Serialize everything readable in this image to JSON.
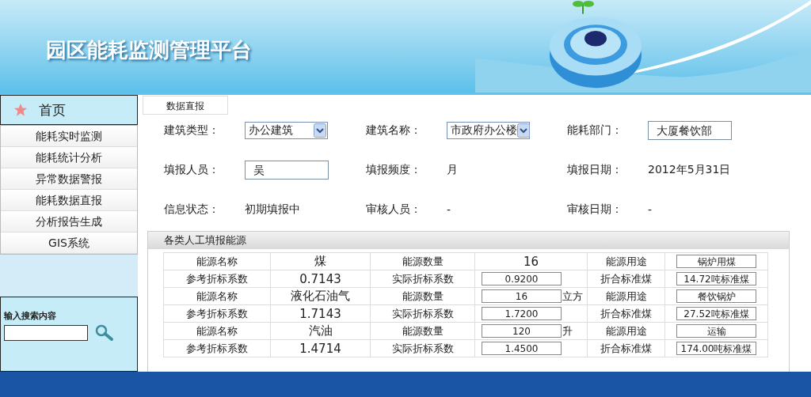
{
  "header": {
    "title": "园区能耗监测管理平台"
  },
  "sidebar": {
    "home": {
      "label": "首页"
    },
    "items": [
      {
        "label": "能耗实时监测"
      },
      {
        "label": "能耗统计分析"
      },
      {
        "label": "异常数据警报"
      },
      {
        "label": "能耗数据直报"
      },
      {
        "label": "分析报告生成"
      },
      {
        "label": "GIS系统"
      }
    ],
    "search": {
      "label": "输入搜索内容"
    }
  },
  "tabs": [
    {
      "label": "数据直报",
      "selected": true
    }
  ],
  "form": {
    "fields": [
      {
        "label": "建筑类型：",
        "kind": "select",
        "value": "办公建筑"
      },
      {
        "label": "建筑名称：",
        "kind": "select",
        "value": "市政府办公楼"
      },
      {
        "label": "能耗部门：",
        "kind": "input",
        "value": "大厦餐饮部"
      },
      {
        "label": "填报人员：",
        "kind": "input",
        "value": "吴"
      },
      {
        "label": "填报频度：",
        "kind": "text",
        "value": "月"
      },
      {
        "label": "填报日期：",
        "kind": "text",
        "value": "2012年5月31日"
      },
      {
        "label": "信息状态：",
        "kind": "text",
        "value": "初期填报中"
      },
      {
        "label": "审核人员：",
        "kind": "text",
        "value": "-"
      },
      {
        "label": "审核日期：",
        "kind": "text",
        "value": "-"
      }
    ]
  },
  "energy_section": {
    "title": "各类人工填报能源",
    "rows": [
      [
        {
          "kind": "label",
          "text": "能源名称"
        },
        {
          "kind": "text",
          "text": "煤"
        },
        {
          "kind": "label",
          "text": "能源数量"
        },
        {
          "kind": "text",
          "text": "16"
        },
        {
          "kind": "label",
          "text": "能源用途"
        },
        {
          "kind": "input",
          "value": "锅炉用煤"
        }
      ],
      [
        {
          "kind": "label",
          "text": "参考折标系数"
        },
        {
          "kind": "text",
          "text": "0.7143"
        },
        {
          "kind": "label",
          "text": "实际折标系数"
        },
        {
          "kind": "input",
          "value": "0.9200"
        },
        {
          "kind": "label",
          "text": "折合标准煤"
        },
        {
          "kind": "input",
          "value": "14.72吨标准煤"
        }
      ],
      [
        {
          "kind": "label",
          "text": "能源名称"
        },
        {
          "kind": "text",
          "text": "液化石油气"
        },
        {
          "kind": "label",
          "text": "能源数量"
        },
        {
          "kind": "input",
          "value": "16",
          "unit": "立方"
        },
        {
          "kind": "label",
          "text": "能源用途"
        },
        {
          "kind": "input",
          "value": "餐饮锅炉"
        }
      ],
      [
        {
          "kind": "label",
          "text": "参考折标系数"
        },
        {
          "kind": "text",
          "text": "1.7143"
        },
        {
          "kind": "label",
          "text": "实际折标系数"
        },
        {
          "kind": "input",
          "value": "1.7200"
        },
        {
          "kind": "label",
          "text": "折合标准煤"
        },
        {
          "kind": "input",
          "value": "27.52吨标准煤"
        }
      ],
      [
        {
          "kind": "label",
          "text": "能源名称"
        },
        {
          "kind": "text",
          "text": "汽油"
        },
        {
          "kind": "label",
          "text": "能源数量"
        },
        {
          "kind": "input",
          "value": "120",
          "unit": "升"
        },
        {
          "kind": "label",
          "text": "能源用途"
        },
        {
          "kind": "input",
          "value": "运输"
        }
      ],
      [
        {
          "kind": "label",
          "text": "参考折标系数"
        },
        {
          "kind": "text",
          "text": "1.4714"
        },
        {
          "kind": "label",
          "text": "实际折标系数"
        },
        {
          "kind": "input",
          "value": "1.4500"
        },
        {
          "kind": "label",
          "text": "折合标准煤"
        },
        {
          "kind": "input",
          "value": "174.00吨标准煤"
        }
      ]
    ]
  }
}
